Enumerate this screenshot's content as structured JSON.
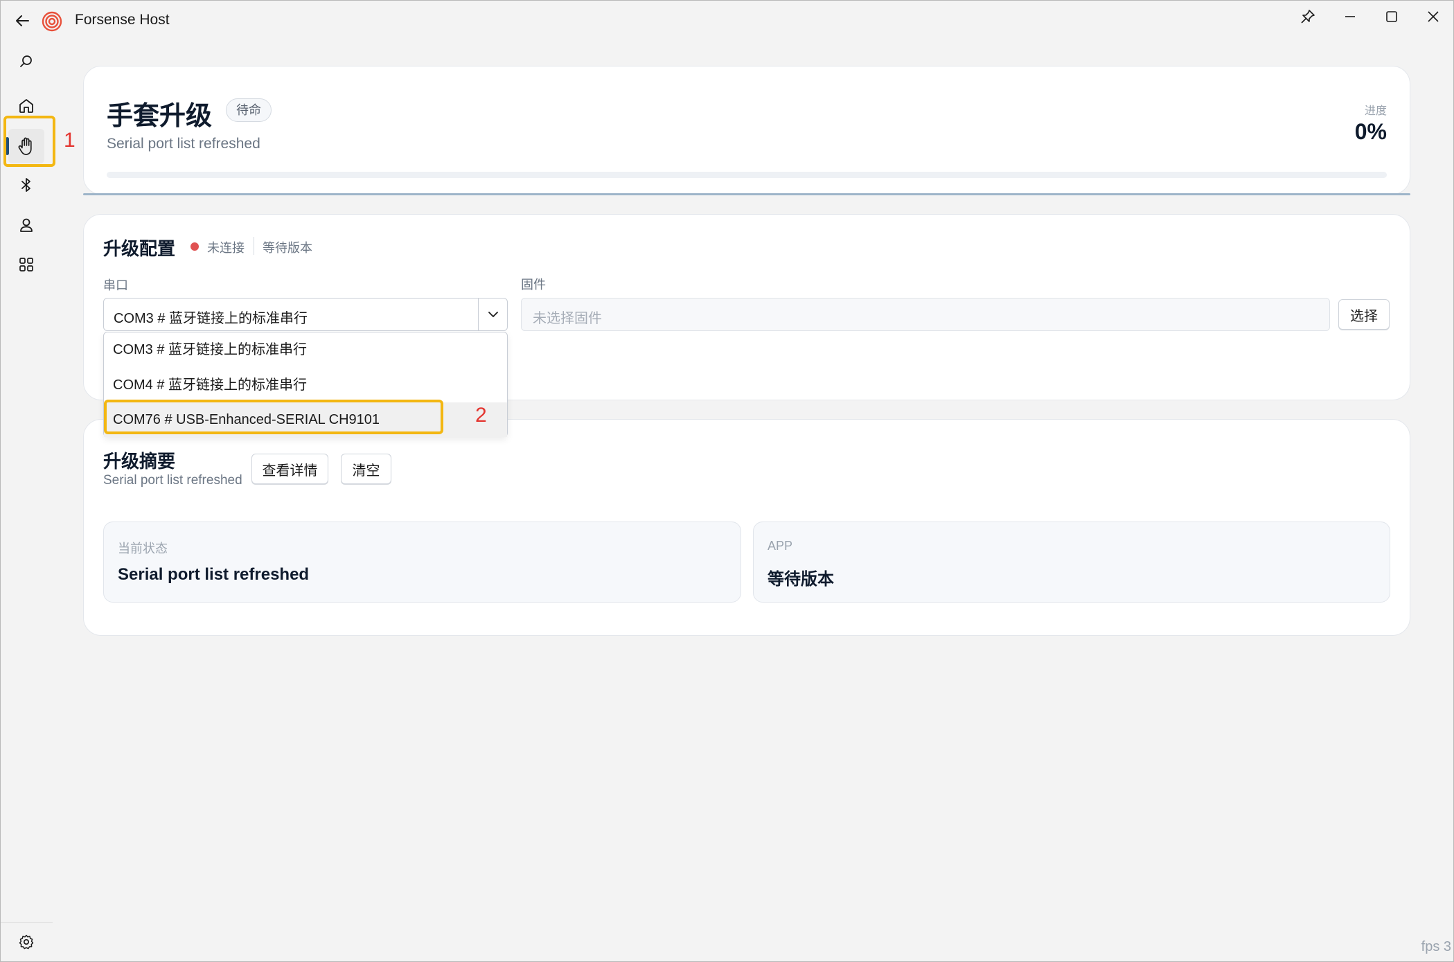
{
  "window": {
    "title": "Forsense Host",
    "fps": "fps 3"
  },
  "sidebar": {
    "items": [
      {
        "name": "search",
        "icon": "search-icon"
      },
      {
        "name": "home",
        "icon": "home-icon"
      },
      {
        "name": "glove",
        "icon": "hand-icon",
        "active": true
      },
      {
        "name": "bluetooth",
        "icon": "bluetooth-icon"
      },
      {
        "name": "user",
        "icon": "user-icon"
      },
      {
        "name": "apps",
        "icon": "grid-icon"
      }
    ],
    "settings_icon": "gear-icon"
  },
  "annotations": {
    "marker_1": "1",
    "marker_2": "2"
  },
  "header": {
    "title": "手套升级",
    "status": "待命",
    "subtitle": "Serial port list refreshed",
    "progress_label": "进度",
    "progress_value": "0%",
    "progress_fraction": 0
  },
  "config": {
    "title": "升级配置",
    "connection_status": "未连接",
    "version_status": "等待版本",
    "port_label": "串口",
    "selected_port": "COM3 # 蓝牙链接上的标准串行",
    "firmware_label": "固件",
    "firmware_placeholder": "未选择固件",
    "choose_button": "选择",
    "port_options": [
      "COM3 # 蓝牙链接上的标准串行",
      "COM4 # 蓝牙链接上的标准串行",
      "COM76 # USB-Enhanced-SERIAL CH9101"
    ]
  },
  "summary": {
    "title": "升级摘要",
    "subtitle": "Serial port list refreshed",
    "details_button": "查看详情",
    "clear_button": "清空",
    "current_state_label": "当前状态",
    "current_state_value": "Serial port list refreshed",
    "app_label": "APP",
    "app_value": "等待版本"
  },
  "colors": {
    "accent": "#1f4e79",
    "highlight": "#f3b712",
    "marker": "#e3342f",
    "disconnected": "#e05252"
  }
}
